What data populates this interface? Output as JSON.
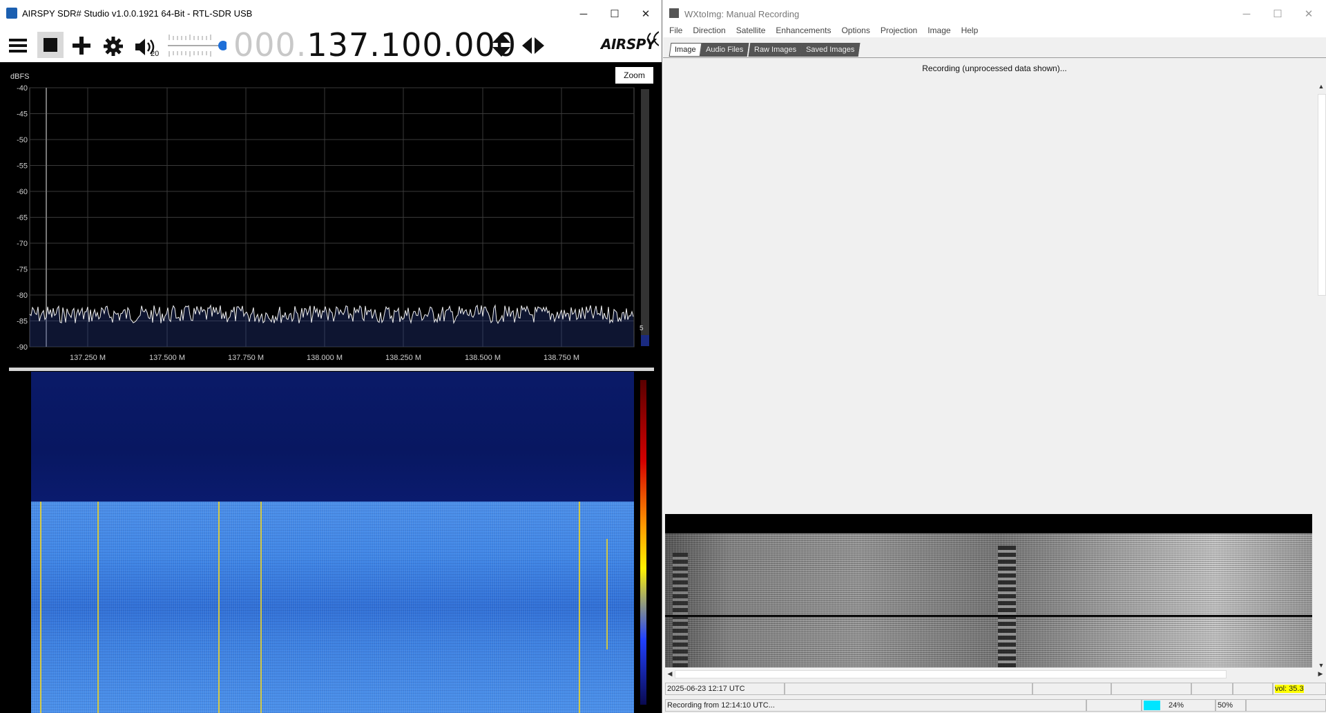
{
  "sdr": {
    "title": "AIRSPY SDR# Studio v1.0.0.1921 64-Bit - RTL-SDR USB",
    "volume_level": "20",
    "frequency_lead": "000.",
    "frequency_main": "137.100.000",
    "logo": "AIRSPY",
    "zoom_label": "Zoom",
    "spectrum": {
      "ylabel": "dBFS",
      "y_ticks": [
        "-40",
        "-45",
        "-50",
        "-55",
        "-60",
        "-65",
        "-70",
        "-75",
        "-80",
        "-85",
        "-90"
      ],
      "x_ticks": [
        "137.250 M",
        "137.500 M",
        "137.750 M",
        "138.000 M",
        "138.250 M",
        "138.500 M",
        "138.750 M"
      ],
      "side_value": "5"
    },
    "icons": {
      "menu": "menu-icon",
      "stop": "stop-icon",
      "add": "plus-icon",
      "settings": "gear-icon",
      "audio": "speaker-icon"
    }
  },
  "wx": {
    "title": "WXtoImg: Manual Recording",
    "menu": [
      "File",
      "Direction",
      "Satellite",
      "Enhancements",
      "Options",
      "Projection",
      "Image",
      "Help"
    ],
    "tabs": [
      "Image",
      "Audio Files",
      "Raw Images",
      "Saved Images"
    ],
    "status_top": "Recording (unprocessed data shown)...",
    "status_date": "2025-06-23  12:17 UTC",
    "status_recording": "Recording from 12:14:10 UTC...",
    "vol": "vol: 35.3",
    "percent1": "24%",
    "percent2": "50%",
    "accent_cyan": "#00e5ff",
    "accent_yellow": "#ffff00"
  }
}
